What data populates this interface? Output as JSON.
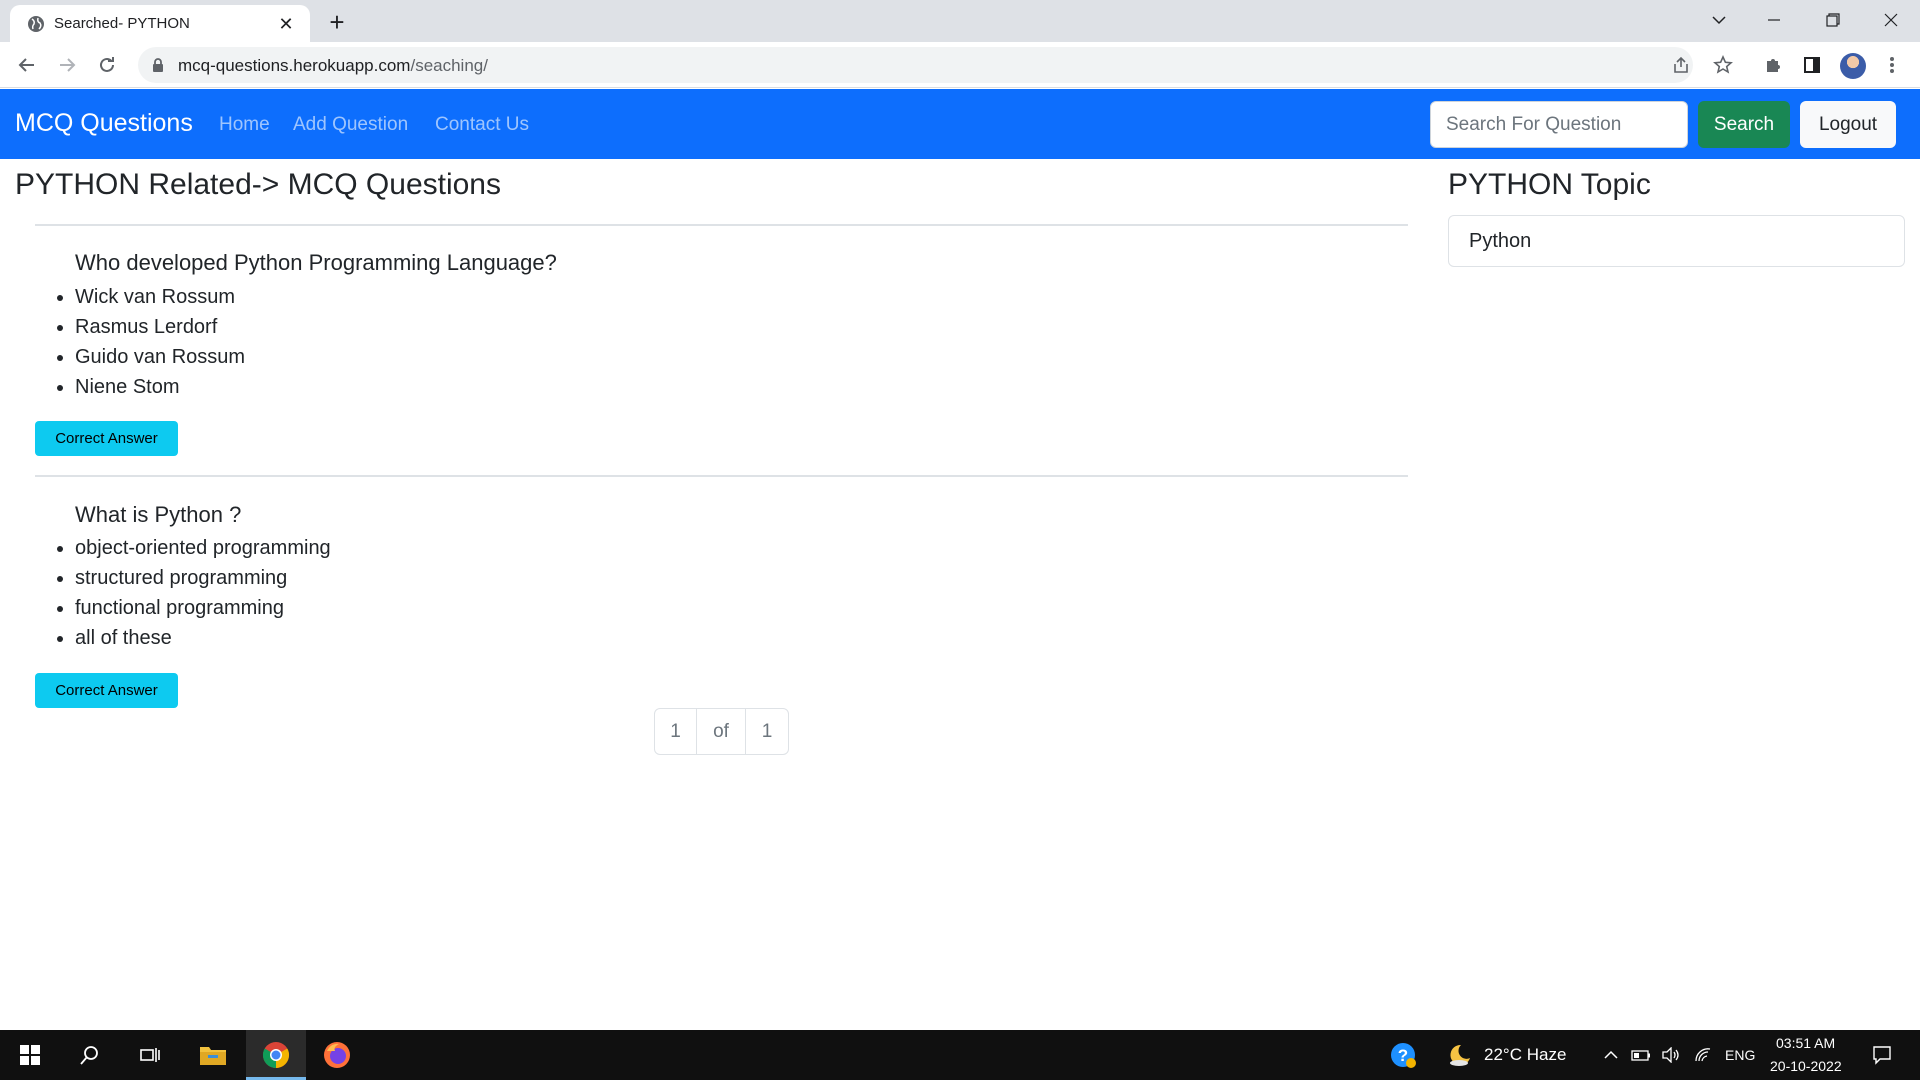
{
  "browser": {
    "tab_title": "Searched- PYTHON",
    "url_host": "mcq-questions.herokuapp.com",
    "url_path": "/seaching/",
    "new_tab": "+",
    "close_tab": "✕"
  },
  "navbar": {
    "brand": "MCQ Questions",
    "links": [
      "Home",
      "Add Question",
      "Contact Us"
    ],
    "search_placeholder": "Search For Question",
    "search_button": "Search",
    "logout_button": "Logout"
  },
  "main": {
    "heading": "PYTHON Related-> MCQ Questions",
    "questions": [
      {
        "question": "Who developed Python Programming Language?",
        "options": [
          "Wick van Rossum",
          "Rasmus Lerdorf",
          "Guido van Rossum",
          "Niene Stom"
        ],
        "button": "Correct Answer"
      },
      {
        "question": "What is Python ?",
        "options": [
          "object-oriented programming",
          "structured programming",
          "functional programming",
          "all of these"
        ],
        "button": "Correct Answer"
      }
    ],
    "pagination": {
      "current": "1",
      "of": "of",
      "total": "1"
    }
  },
  "sidebar": {
    "heading": "PYTHON Topic",
    "topics": [
      "Python"
    ]
  },
  "taskbar": {
    "weather": "22°C  Haze",
    "language": "ENG",
    "time": "03:51 AM",
    "date": "20-10-2022"
  },
  "colors": {
    "navbar": "#0d6efd",
    "search_button": "#198754",
    "answer_button": "#0dcaf0"
  }
}
